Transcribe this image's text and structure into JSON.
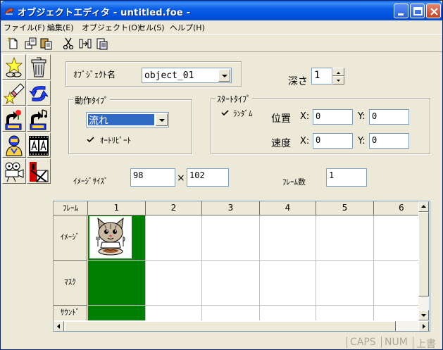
{
  "window": {
    "title": "オブジェクトエディタ - untitled.foe -"
  },
  "menu": [
    {
      "label": "ファイル(F)"
    },
    {
      "label": "編集(E)"
    },
    {
      "label": "オブジェクト(O)"
    },
    {
      "label": "セル(S)"
    },
    {
      "label": "ヘルプ(H)"
    }
  ],
  "toolbar": {
    "icons": [
      "new-icon",
      "copy-icon",
      "paste-icon",
      "cut-icon",
      "insert-icon",
      "clipboard-icon"
    ]
  },
  "palette": {
    "icons": [
      "star-link-icon",
      "trash-icon",
      "star-eraser-icon",
      "swap-arrows-icon",
      "flower-loop-icon",
      "music-loop-icon",
      "character-icon",
      "text-aa-icon",
      "projector-icon",
      "delete-frame-icon"
    ]
  },
  "object": {
    "name_label": "ｵﾌﾞｼﾞｪｸﾄ名",
    "name_value": "object_01",
    "depth_label": "深さ",
    "depth_value": "1"
  },
  "motion": {
    "group_label": "動作ﾀｲﾌﾟ",
    "type_value": "流れ",
    "autorepeat_label": "ｵｰﾄﾘﾋﾟｰﾄ",
    "autorepeat_checked": true
  },
  "start": {
    "group_label": "ｽﾀｰﾄﾀｲﾌﾟ",
    "random_label": "ﾗﾝﾀﾞﾑ",
    "random_checked": true,
    "position_label": "位置",
    "speed_label": "速度",
    "x_label": "X:",
    "y_label": "Y:",
    "pos_x": "0",
    "pos_y": "0",
    "speed_x": "0",
    "speed_y": "0"
  },
  "image": {
    "size_label": "ｲﾒｰｼﾞｻｲｽﾞ",
    "width": "98",
    "times": "×",
    "height": "102",
    "frames_label": "ﾌﾚｰﾑ数",
    "frames_value": "1"
  },
  "grid": {
    "corner_label": "ﾌﾚｰﾑ",
    "columns": [
      "1",
      "2",
      "3",
      "4",
      "5",
      "6"
    ],
    "rows": [
      "ｲﾒｰｼﾞ",
      "ﾏｽｸ",
      "ｻｳﾝﾄﾞ"
    ]
  },
  "status": {
    "caps": "CAPS",
    "num": "NUM",
    "mode": "上書"
  },
  "colors": {
    "titlebar": "#0058e6",
    "filled_cell": "#008000",
    "selected_combo": "#316ac5"
  }
}
